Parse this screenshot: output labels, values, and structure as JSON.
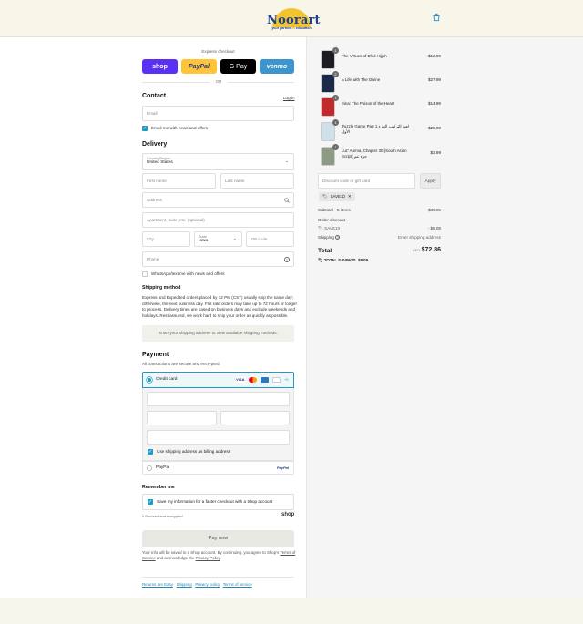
{
  "brand": {
    "name": "Noorart",
    "tagline_pre": "your partner ",
    "tagline_in": "in",
    "tagline_post": " education"
  },
  "express": {
    "label": "Express checkout",
    "or": "OR",
    "buttons": [
      "shop",
      "PayPal",
      "G Pay",
      "venmo"
    ]
  },
  "contact": {
    "heading": "Contact",
    "login": "Log in",
    "email_placeholder": "Email",
    "news_label": "Email me with news and offers"
  },
  "delivery": {
    "heading": "Delivery",
    "country_label": "Country/Region",
    "country_value": "United States",
    "first_name": "First name",
    "last_name": "Last name",
    "address": "Address",
    "apartment": "Apartment, suite, etc. (optional)",
    "city": "City",
    "state_label": "State",
    "state_value": "Iowa",
    "zip": "ZIP code",
    "phone": "Phone",
    "whatsapp": "WhatsApp/text me with news and offers"
  },
  "shipping": {
    "heading": "Shipping method",
    "notice": "Express and Expedited orders placed by 12 PM (CST) usually ship the same day; otherwise, the next business day. Flat rate orders may take up to 72 hours or longer to process. Delivery times are based on business days and exclude weekends and holidays. Rest assured, we work hard to ship your order as quickly as possible.",
    "placeholder": "Enter your shipping address to view available shipping methods."
  },
  "payment": {
    "heading": "Payment",
    "sub": "All transactions are secure and encrypted.",
    "credit_card": "Credit card",
    "billing": "Use shipping address as billing address",
    "paypal": "PayPal",
    "paypal_logo": "PayPal"
  },
  "remember": {
    "heading": "Remember me",
    "save": "Save my information for a faster checkout with a Shop account",
    "secure": "Secured and encrypted",
    "shop_logo": "shop"
  },
  "pay_button": "Pay now",
  "legal": {
    "pre": "Your info will be saved to a Shop account. By continuing, you agree to Shop's ",
    "tos": "Terms of Service",
    "mid": " and acknowledge the ",
    "privacy": "Privacy Policy",
    "post": "."
  },
  "footer_links": [
    "Returns are Easy",
    "Shipping",
    "Privacy policy",
    "Terms of service"
  ],
  "items": [
    {
      "qty": "1",
      "title": "The Virtues of Dhul Hijjah",
      "price": "$12.99",
      "color": "#1c1c24"
    },
    {
      "qty": "2",
      "title": "A Life with The Divine",
      "price": "$27.99",
      "color": "#1c2a4a"
    },
    {
      "qty": "1",
      "title": "Sina: The Poison of the Heart",
      "price": "$14.99",
      "color": "#c2282c"
    },
    {
      "qty": "1",
      "title": "Puzzle Game Part 1 لعبة التركيب الجزء الأول",
      "price": "$20.99",
      "color": "#cfe0ea"
    },
    {
      "qty": "1",
      "title": "Juz' Amma, Chapter 30 (South Asian Script) جزء عم",
      "price": "$3.99",
      "color": "#8d9a86"
    }
  ],
  "summary": {
    "discount_placeholder": "Discount code or gift card",
    "apply": "Apply",
    "code": "SAVE10",
    "subtotal_label": "Subtotal · 5 items",
    "subtotal": "$80.95",
    "order_discount": "Order discount",
    "discount_code": "SAVE10",
    "discount_value": "- $8.09",
    "shipping_label": "Shipping",
    "shipping_value": "Enter shipping address",
    "total_label": "Total",
    "currency": "USD",
    "total": "$72.86",
    "savings_label": "TOTAL SAVINGS",
    "savings": "$8.09"
  }
}
